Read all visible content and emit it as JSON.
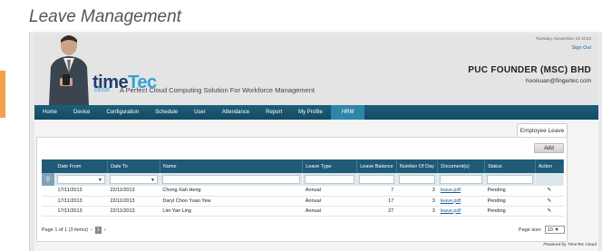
{
  "page": {
    "title": "Leave Management"
  },
  "header": {
    "logo": {
      "time": "time",
      "tec": "Tec",
      "cloud": "cloud"
    },
    "tagline": "A Perfect Cloud Computing Solution For Workforce Management",
    "date": "Tuesday, November 19 2013",
    "signout": "Sign Out",
    "company": "PUC FOUNDER (MSC) BHD",
    "email": "hooisuan@fingertec.com"
  },
  "nav": {
    "items": [
      "Home",
      "Device",
      "Configuration",
      "Schedule",
      "User",
      "Attendance",
      "Report",
      "My Profile",
      "HRM"
    ],
    "active": "HRM"
  },
  "tabs": {
    "employee_leave": "Employee Leave"
  },
  "toolbar": {
    "add_label": "Add"
  },
  "table": {
    "columns": [
      "Date From",
      "Date To",
      "Name",
      "Leave Type",
      "Leave Balance",
      "Number Of Day",
      "Document(s)",
      "Status",
      "Action"
    ],
    "rows": [
      {
        "date_from": "17/11/2013",
        "date_to": "22/11/2013",
        "name": "Chong Xah Heng",
        "leave_type": "Annual",
        "balance": "7",
        "days": "3",
        "doc": "leave.pdf",
        "status": "Pending"
      },
      {
        "date_from": "17/11/2013",
        "date_to": "22/11/2013",
        "name": "Daryl Choo Yuan Yew",
        "leave_type": "Annual",
        "balance": "17",
        "days": "3",
        "doc": "leave.pdf",
        "status": "Pending"
      },
      {
        "date_from": "17/11/2013",
        "date_to": "22/11/2013",
        "name": "Lim Yan Ling",
        "leave_type": "Annual",
        "balance": "27",
        "days": "3",
        "doc": "leave.pdf",
        "status": "Pending"
      }
    ]
  },
  "pager": {
    "info": "Page 1 of 1 (3 items)",
    "prev": "‹",
    "current": "1",
    "next": "›",
    "size_label": "Page size:",
    "size_value": "10"
  },
  "footer": {
    "powered": "Powered by TimeTec Cloud"
  },
  "colors": {
    "nav": "#1e5e7a",
    "nav_active": "#2e86a8",
    "header_bg": "#e4e4e4",
    "accent": "#f2a24a"
  }
}
